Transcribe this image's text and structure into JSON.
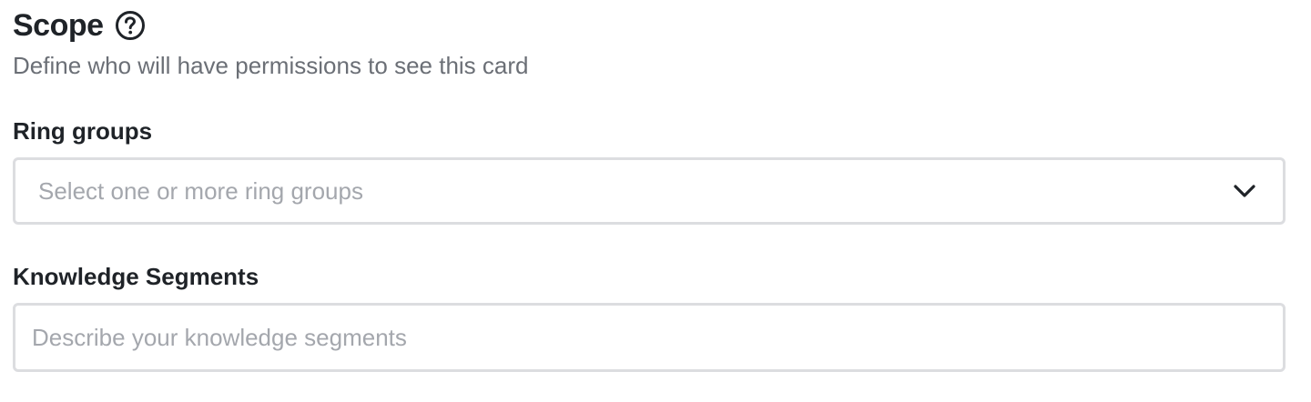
{
  "header": {
    "title": "Scope",
    "subtitle": "Define who will have permissions to see this card",
    "help_icon": "question-circle-icon"
  },
  "fields": {
    "ring_groups": {
      "label": "Ring groups",
      "placeholder": "Select one or more ring groups",
      "icon": "chevron-down-icon"
    },
    "knowledge_segments": {
      "label": "Knowledge Segments",
      "placeholder": "Describe your knowledge segments"
    }
  },
  "colors": {
    "text_primary": "#1f2328",
    "text_secondary": "#6b6f76",
    "placeholder": "#a4a7ad",
    "border": "#dcdde0"
  }
}
